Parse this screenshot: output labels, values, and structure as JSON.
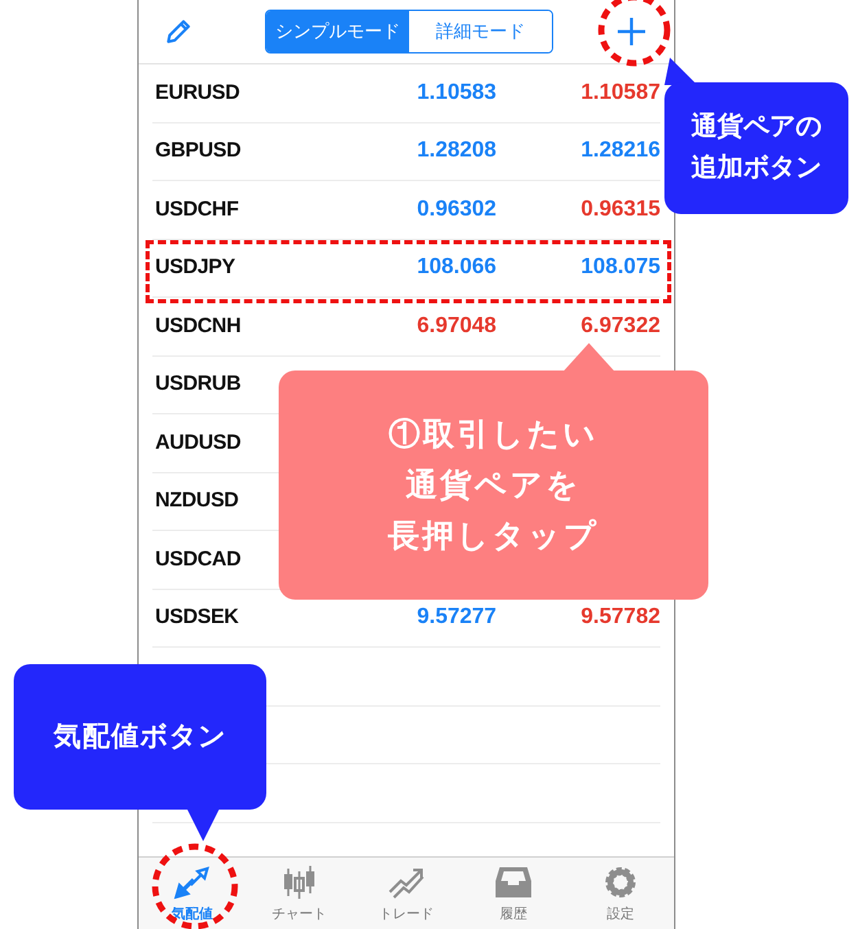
{
  "header": {
    "modes": [
      {
        "label": "シンプルモード",
        "selected": true
      },
      {
        "label": "詳細モード",
        "selected": false
      }
    ]
  },
  "quotes": [
    {
      "symbol": "EURUSD",
      "bid": {
        "text": "1.10583",
        "color": "#1a82f7"
      },
      "ask": {
        "text": "1.10587",
        "color": "#e6392d"
      }
    },
    {
      "symbol": "GBPUSD",
      "bid": {
        "text": "1.28208",
        "color": "#1a82f7"
      },
      "ask": {
        "text": "1.28216",
        "color": "#1a82f7"
      }
    },
    {
      "symbol": "USDCHF",
      "bid": {
        "text": "0.96302",
        "color": "#1a82f7"
      },
      "ask": {
        "text": "0.96315",
        "color": "#e6392d"
      }
    },
    {
      "symbol": "USDJPY",
      "bid": {
        "text": "108.066",
        "color": "#1a82f7"
      },
      "ask": {
        "text": "108.075",
        "color": "#1a82f7"
      }
    },
    {
      "symbol": "USDCNH",
      "bid": {
        "text": "6.97048",
        "color": "#e6392d"
      },
      "ask": {
        "text": "6.97322",
        "color": "#e6392d"
      }
    },
    {
      "symbol": "USDRUB"
    },
    {
      "symbol": "AUDUSD"
    },
    {
      "symbol": "NZDUSD"
    },
    {
      "symbol": "USDCAD"
    },
    {
      "symbol": "USDSEK",
      "bid": {
        "text": "9.57277",
        "color": "#1a82f7"
      },
      "ask": {
        "text": "9.57782",
        "color": "#e6392d"
      }
    }
  ],
  "tab_bar": [
    {
      "label": "気配値",
      "selected": true
    },
    {
      "label": "チャート",
      "selected": false
    },
    {
      "label": "トレード",
      "selected": false
    },
    {
      "label": "履歴",
      "selected": false
    },
    {
      "label": "設定",
      "selected": false
    }
  ],
  "annotations": [
    {
      "kind": "blue-top",
      "lines": [
        "通貨ペアの",
        "追加ボタン"
      ]
    },
    {
      "kind": "pink",
      "lines": [
        "①取引したい",
        "通貨ペアを",
        "長押しタップ"
      ]
    },
    {
      "kind": "blue-bottom",
      "lines": [
        "気配値ボタン"
      ]
    }
  ]
}
